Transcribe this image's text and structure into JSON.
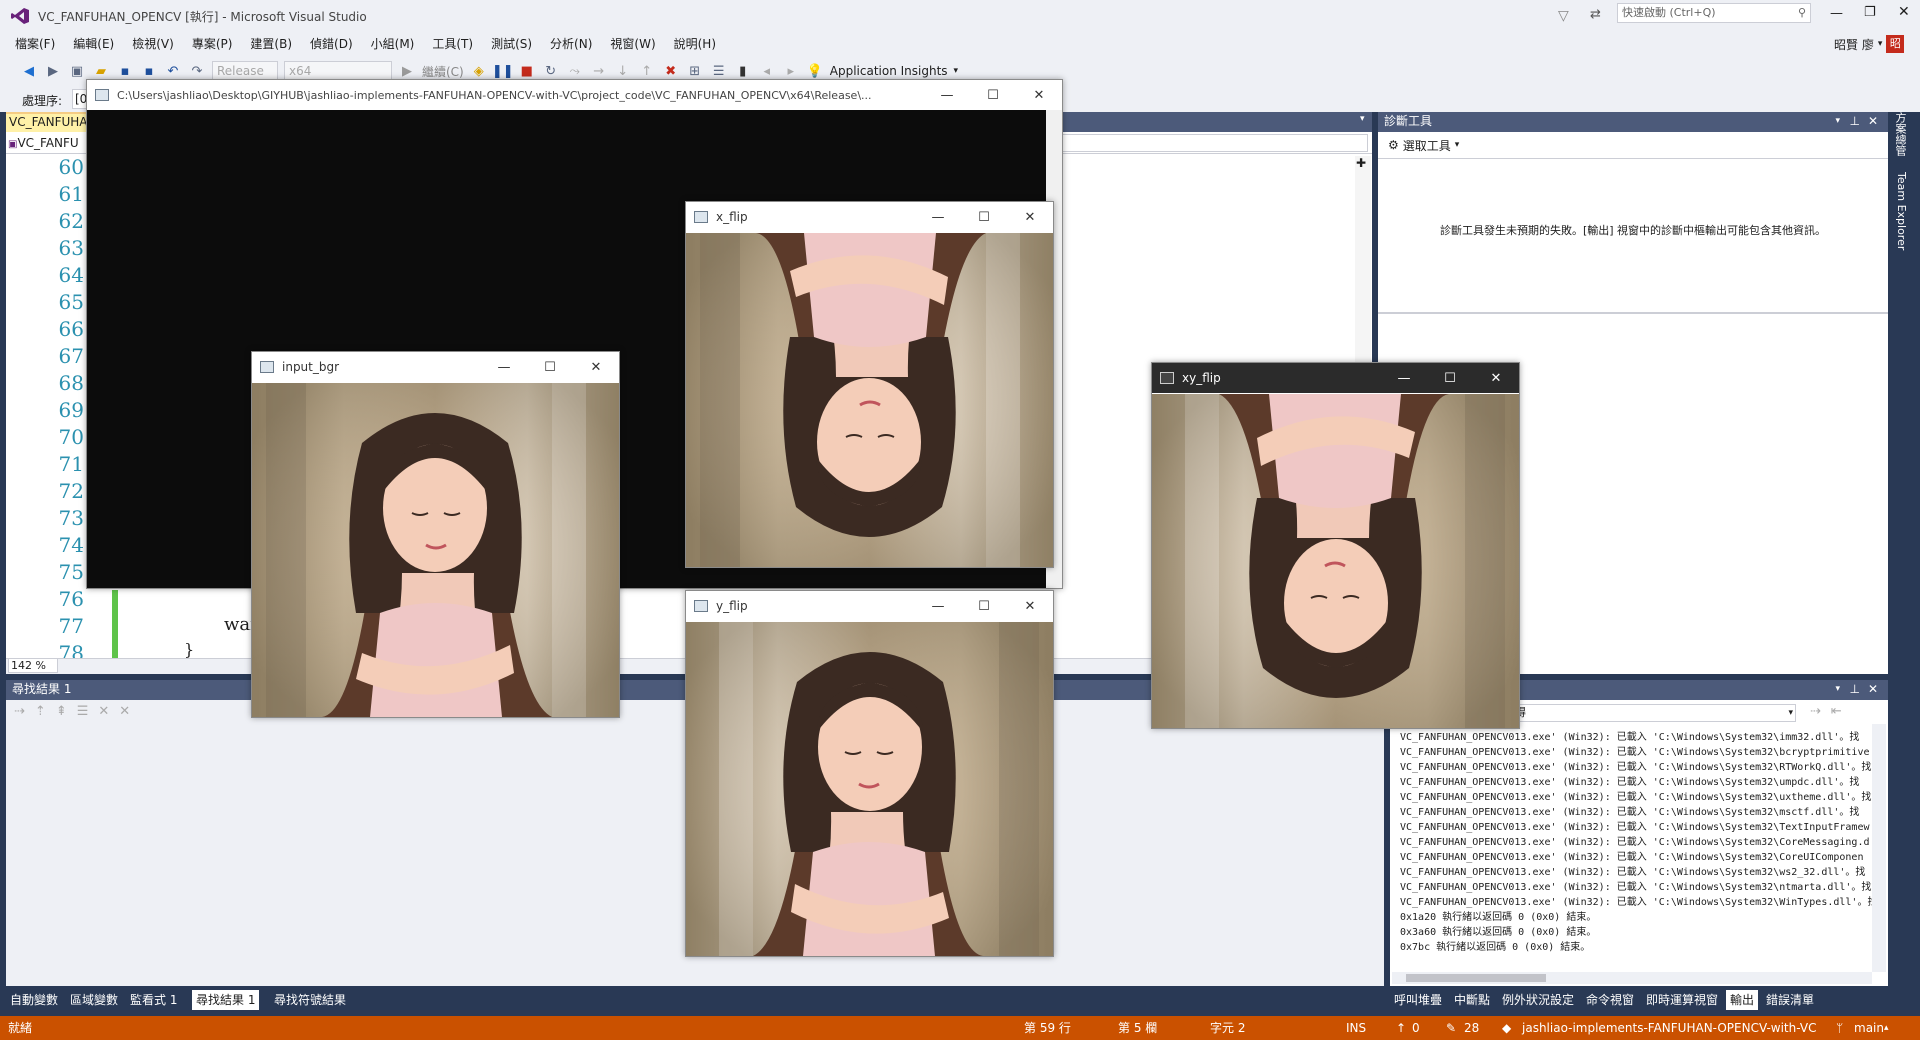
{
  "app": {
    "window_title": "VC_FANFUHAN_OPENCV [執行] - Microsoft Visual Studio",
    "quick_launch_placeholder": "快速啟動 (Ctrl+Q)",
    "user_name": "昭賢 廖",
    "user_initial": "昭"
  },
  "menu": [
    "檔案(F)",
    "編輯(E)",
    "檢視(V)",
    "專案(P)",
    "建置(B)",
    "偵錯(D)",
    "小組(M)",
    "工具(T)",
    "測試(S)",
    "分析(N)",
    "視窗(W)",
    "說明(H)"
  ],
  "toolbar": {
    "config": "Release",
    "platform": "x64",
    "continue_label": "繼續(C)",
    "app_insights_label": "Application Insights",
    "process_label": "處理序:",
    "process_value": "[0"
  },
  "editor": {
    "tab_label": "VC_FANFUHA",
    "nav_label": "VC_FANFU",
    "line_numbers": [
      "60",
      "61",
      "62",
      "63",
      "64",
      "65",
      "66",
      "67",
      "68",
      "69",
      "70",
      "71",
      "72",
      "73",
      "74",
      "75",
      "76",
      "77",
      "78"
    ],
    "code_fragment_1": "wai",
    "code_fragment_2": "}",
    "zoom": "142 %"
  },
  "console": {
    "title": "C:\\Users\\jashliao\\Desktop\\GIYHUB\\jashliao-implements-FANFUHAN-OPENCV-with-VC\\project_code\\VC_FANFUHAN_OPENCV\\x64\\Release\\..."
  },
  "cv_windows": [
    {
      "id": "input_bgr",
      "title": "input_bgr",
      "flip": "none"
    },
    {
      "id": "x_flip",
      "title": "x_flip",
      "flip": "vertical"
    },
    {
      "id": "y_flip",
      "title": "y_flip",
      "flip": "horizontal"
    },
    {
      "id": "xy_flip",
      "title": "xy_flip",
      "flip": "both"
    }
  ],
  "diagnostics": {
    "title": "診斷工具",
    "select_tools": "選取工具",
    "message": "診斷工具發生未預期的失敗。[輸出] 視窗中的診斷中樞輸出可能包含其他資訊。"
  },
  "side_tabs": [
    "方案總管",
    "Team Explorer"
  ],
  "find_results": {
    "title": "尋找結果 1"
  },
  "bottom_left_tabs": [
    "自動變數",
    "區域變數",
    "監看式 1",
    "尋找結果 1",
    "尋找符號結果"
  ],
  "bottom_left_active": 3,
  "output": {
    "combo_fragment": "得",
    "lines": [
      "VC_FANFUHAN_OPENCV013.exe' (Win32): 已載入 'C:\\Windows\\System32\\imm32.dll'。找",
      "VC_FANFUHAN_OPENCV013.exe' (Win32): 已載入 'C:\\Windows\\System32\\bcryptprimitive",
      "VC_FANFUHAN_OPENCV013.exe' (Win32): 已載入 'C:\\Windows\\System32\\RTWorkQ.dll'。找",
      "VC_FANFUHAN_OPENCV013.exe' (Win32): 已載入 'C:\\Windows\\System32\\umpdc.dll'。找",
      "VC_FANFUHAN_OPENCV013.exe' (Win32): 已載入 'C:\\Windows\\System32\\uxtheme.dll'。找",
      "VC_FANFUHAN_OPENCV013.exe' (Win32): 已載入 'C:\\Windows\\System32\\msctf.dll'。找",
      "VC_FANFUHAN_OPENCV013.exe' (Win32): 已載入 'C:\\Windows\\System32\\TextInputFramew",
      "VC_FANFUHAN_OPENCV013.exe' (Win32): 已載入 'C:\\Windows\\System32\\CoreMessaging.d",
      "VC_FANFUHAN_OPENCV013.exe' (Win32): 已載入 'C:\\Windows\\System32\\CoreUIComponen",
      "VC_FANFUHAN_OPENCV013.exe' (Win32): 已載入 'C:\\Windows\\System32\\ws2_32.dll'。找",
      "VC_FANFUHAN_OPENCV013.exe' (Win32): 已載入 'C:\\Windows\\System32\\ntmarta.dll'。找",
      "VC_FANFUHAN_OPENCV013.exe' (Win32): 已載入 'C:\\Windows\\System32\\WinTypes.dll'。找",
      "0x1a20 執行緒以返回碼 0 (0x0) 結束。",
      "0x3a60 執行緒以返回碼 0 (0x0) 結束。",
      "0x7bc 執行緒以返回碼 0 (0x0) 結束。"
    ]
  },
  "bottom_right_tabs": [
    "呼叫堆疊",
    "中斷點",
    "例外狀況設定",
    "命令視窗",
    "即時運算視窗",
    "輸出",
    "錯誤清單"
  ],
  "bottom_right_active": 5,
  "status": {
    "ready": "就緒",
    "line": "第 59 行",
    "col": "第 5 欄",
    "char": "字元 2",
    "mode": "INS",
    "up_count": "0",
    "edit_count": "28",
    "repo": "jashliao-implements-FANFUHAN-OPENCV-with-VC",
    "branch": "main"
  },
  "colors": {
    "accent_status": "#ca5100",
    "chrome": "#eef0f5",
    "frame": "#293955"
  }
}
